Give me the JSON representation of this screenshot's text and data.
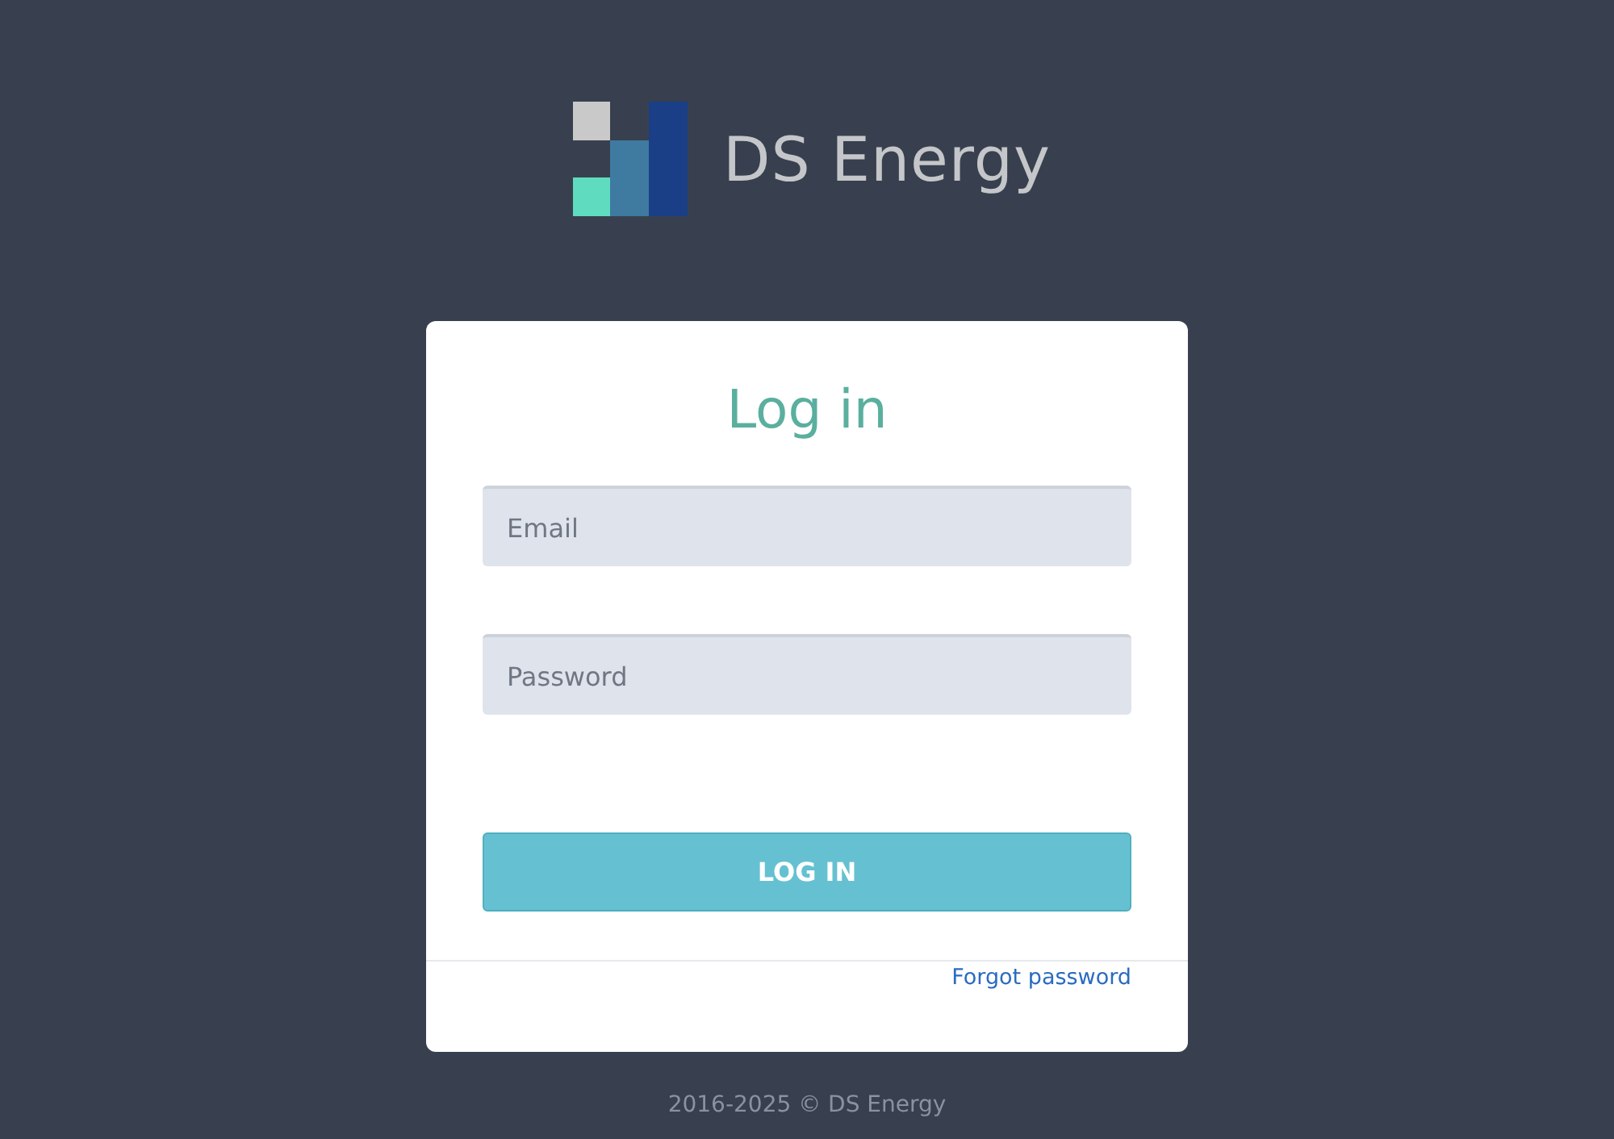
{
  "logo": {
    "text": "DS Energy"
  },
  "form": {
    "title": "Log in",
    "fields": [
      {
        "placeholder": "Email"
      },
      {
        "placeholder": "Password"
      }
    ],
    "submit": "LOG IN",
    "forgot_link": "Forgot password"
  },
  "footer": "2016-2025 © DS Energy"
}
